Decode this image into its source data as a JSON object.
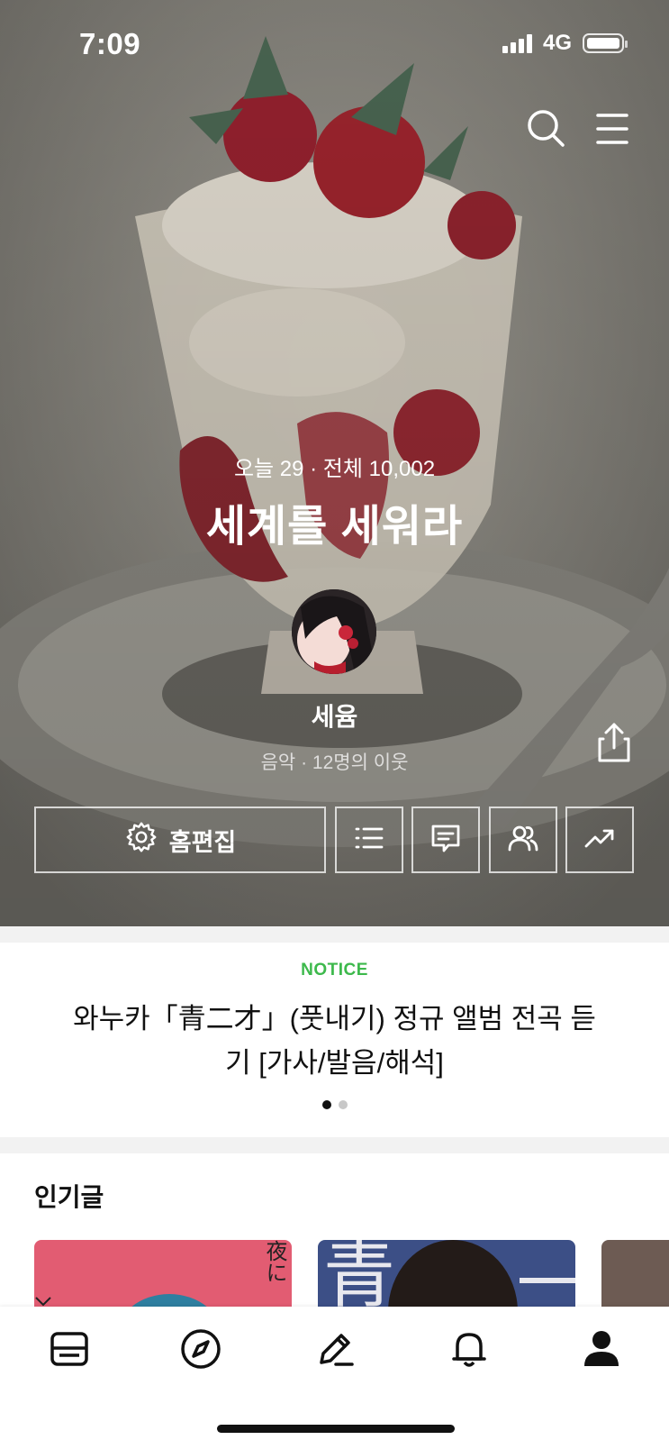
{
  "status_bar": {
    "time": "7:09",
    "network": "4G"
  },
  "blog": {
    "stats": "오늘 29 · 전체 10,002",
    "title": "세계를 세워라",
    "nickname": "세윰",
    "meta": "음악 · 12명의 이웃",
    "edit_label": "홈편집"
  },
  "notice": {
    "tag": "NOTICE",
    "title": "와누카「青二才」(풋내기) 정규 앨범 전곡 듣기 [가사/발음/해석]",
    "page_count": 2,
    "current_page": 1
  },
  "popular": {
    "heading": "인기글",
    "card1_text": "夜に",
    "card2_text": "青"
  },
  "icons": {
    "search": "search-icon",
    "menu": "menu-icon",
    "share": "share-icon",
    "settings": "gear-icon",
    "list": "list-icon",
    "guestbook": "chat-bubble-icon",
    "neighbors": "people-icon",
    "stats": "trend-icon",
    "tabs": [
      "feed-icon",
      "compass-icon",
      "pencil-icon",
      "bell-icon",
      "person-icon"
    ]
  },
  "colors": {
    "notice_green": "#3db94c",
    "active_dot": "#111111"
  }
}
